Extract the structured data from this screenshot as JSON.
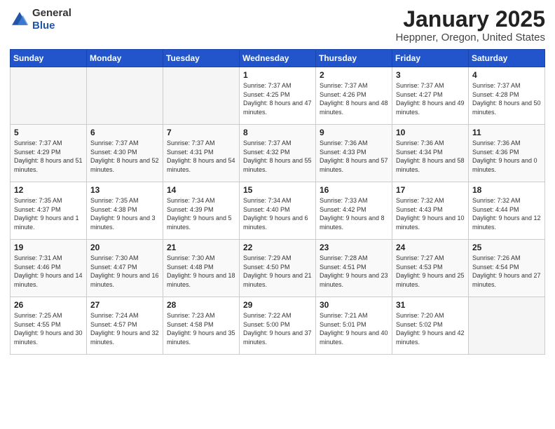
{
  "logo": {
    "general": "General",
    "blue": "Blue"
  },
  "header": {
    "month": "January 2025",
    "location": "Heppner, Oregon, United States"
  },
  "weekdays": [
    "Sunday",
    "Monday",
    "Tuesday",
    "Wednesday",
    "Thursday",
    "Friday",
    "Saturday"
  ],
  "weeks": [
    [
      {
        "day": "",
        "info": ""
      },
      {
        "day": "",
        "info": ""
      },
      {
        "day": "",
        "info": ""
      },
      {
        "day": "1",
        "info": "Sunrise: 7:37 AM\nSunset: 4:25 PM\nDaylight: 8 hours and 47 minutes."
      },
      {
        "day": "2",
        "info": "Sunrise: 7:37 AM\nSunset: 4:26 PM\nDaylight: 8 hours and 48 minutes."
      },
      {
        "day": "3",
        "info": "Sunrise: 7:37 AM\nSunset: 4:27 PM\nDaylight: 8 hours and 49 minutes."
      },
      {
        "day": "4",
        "info": "Sunrise: 7:37 AM\nSunset: 4:28 PM\nDaylight: 8 hours and 50 minutes."
      }
    ],
    [
      {
        "day": "5",
        "info": "Sunrise: 7:37 AM\nSunset: 4:29 PM\nDaylight: 8 hours and 51 minutes."
      },
      {
        "day": "6",
        "info": "Sunrise: 7:37 AM\nSunset: 4:30 PM\nDaylight: 8 hours and 52 minutes."
      },
      {
        "day": "7",
        "info": "Sunrise: 7:37 AM\nSunset: 4:31 PM\nDaylight: 8 hours and 54 minutes."
      },
      {
        "day": "8",
        "info": "Sunrise: 7:37 AM\nSunset: 4:32 PM\nDaylight: 8 hours and 55 minutes."
      },
      {
        "day": "9",
        "info": "Sunrise: 7:36 AM\nSunset: 4:33 PM\nDaylight: 8 hours and 57 minutes."
      },
      {
        "day": "10",
        "info": "Sunrise: 7:36 AM\nSunset: 4:34 PM\nDaylight: 8 hours and 58 minutes."
      },
      {
        "day": "11",
        "info": "Sunrise: 7:36 AM\nSunset: 4:36 PM\nDaylight: 9 hours and 0 minutes."
      }
    ],
    [
      {
        "day": "12",
        "info": "Sunrise: 7:35 AM\nSunset: 4:37 PM\nDaylight: 9 hours and 1 minute."
      },
      {
        "day": "13",
        "info": "Sunrise: 7:35 AM\nSunset: 4:38 PM\nDaylight: 9 hours and 3 minutes."
      },
      {
        "day": "14",
        "info": "Sunrise: 7:34 AM\nSunset: 4:39 PM\nDaylight: 9 hours and 5 minutes."
      },
      {
        "day": "15",
        "info": "Sunrise: 7:34 AM\nSunset: 4:40 PM\nDaylight: 9 hours and 6 minutes."
      },
      {
        "day": "16",
        "info": "Sunrise: 7:33 AM\nSunset: 4:42 PM\nDaylight: 9 hours and 8 minutes."
      },
      {
        "day": "17",
        "info": "Sunrise: 7:32 AM\nSunset: 4:43 PM\nDaylight: 9 hours and 10 minutes."
      },
      {
        "day": "18",
        "info": "Sunrise: 7:32 AM\nSunset: 4:44 PM\nDaylight: 9 hours and 12 minutes."
      }
    ],
    [
      {
        "day": "19",
        "info": "Sunrise: 7:31 AM\nSunset: 4:46 PM\nDaylight: 9 hours and 14 minutes."
      },
      {
        "day": "20",
        "info": "Sunrise: 7:30 AM\nSunset: 4:47 PM\nDaylight: 9 hours and 16 minutes."
      },
      {
        "day": "21",
        "info": "Sunrise: 7:30 AM\nSunset: 4:48 PM\nDaylight: 9 hours and 18 minutes."
      },
      {
        "day": "22",
        "info": "Sunrise: 7:29 AM\nSunset: 4:50 PM\nDaylight: 9 hours and 21 minutes."
      },
      {
        "day": "23",
        "info": "Sunrise: 7:28 AM\nSunset: 4:51 PM\nDaylight: 9 hours and 23 minutes."
      },
      {
        "day": "24",
        "info": "Sunrise: 7:27 AM\nSunset: 4:53 PM\nDaylight: 9 hours and 25 minutes."
      },
      {
        "day": "25",
        "info": "Sunrise: 7:26 AM\nSunset: 4:54 PM\nDaylight: 9 hours and 27 minutes."
      }
    ],
    [
      {
        "day": "26",
        "info": "Sunrise: 7:25 AM\nSunset: 4:55 PM\nDaylight: 9 hours and 30 minutes."
      },
      {
        "day": "27",
        "info": "Sunrise: 7:24 AM\nSunset: 4:57 PM\nDaylight: 9 hours and 32 minutes."
      },
      {
        "day": "28",
        "info": "Sunrise: 7:23 AM\nSunset: 4:58 PM\nDaylight: 9 hours and 35 minutes."
      },
      {
        "day": "29",
        "info": "Sunrise: 7:22 AM\nSunset: 5:00 PM\nDaylight: 9 hours and 37 minutes."
      },
      {
        "day": "30",
        "info": "Sunrise: 7:21 AM\nSunset: 5:01 PM\nDaylight: 9 hours and 40 minutes."
      },
      {
        "day": "31",
        "info": "Sunrise: 7:20 AM\nSunset: 5:02 PM\nDaylight: 9 hours and 42 minutes."
      },
      {
        "day": "",
        "info": ""
      }
    ]
  ]
}
